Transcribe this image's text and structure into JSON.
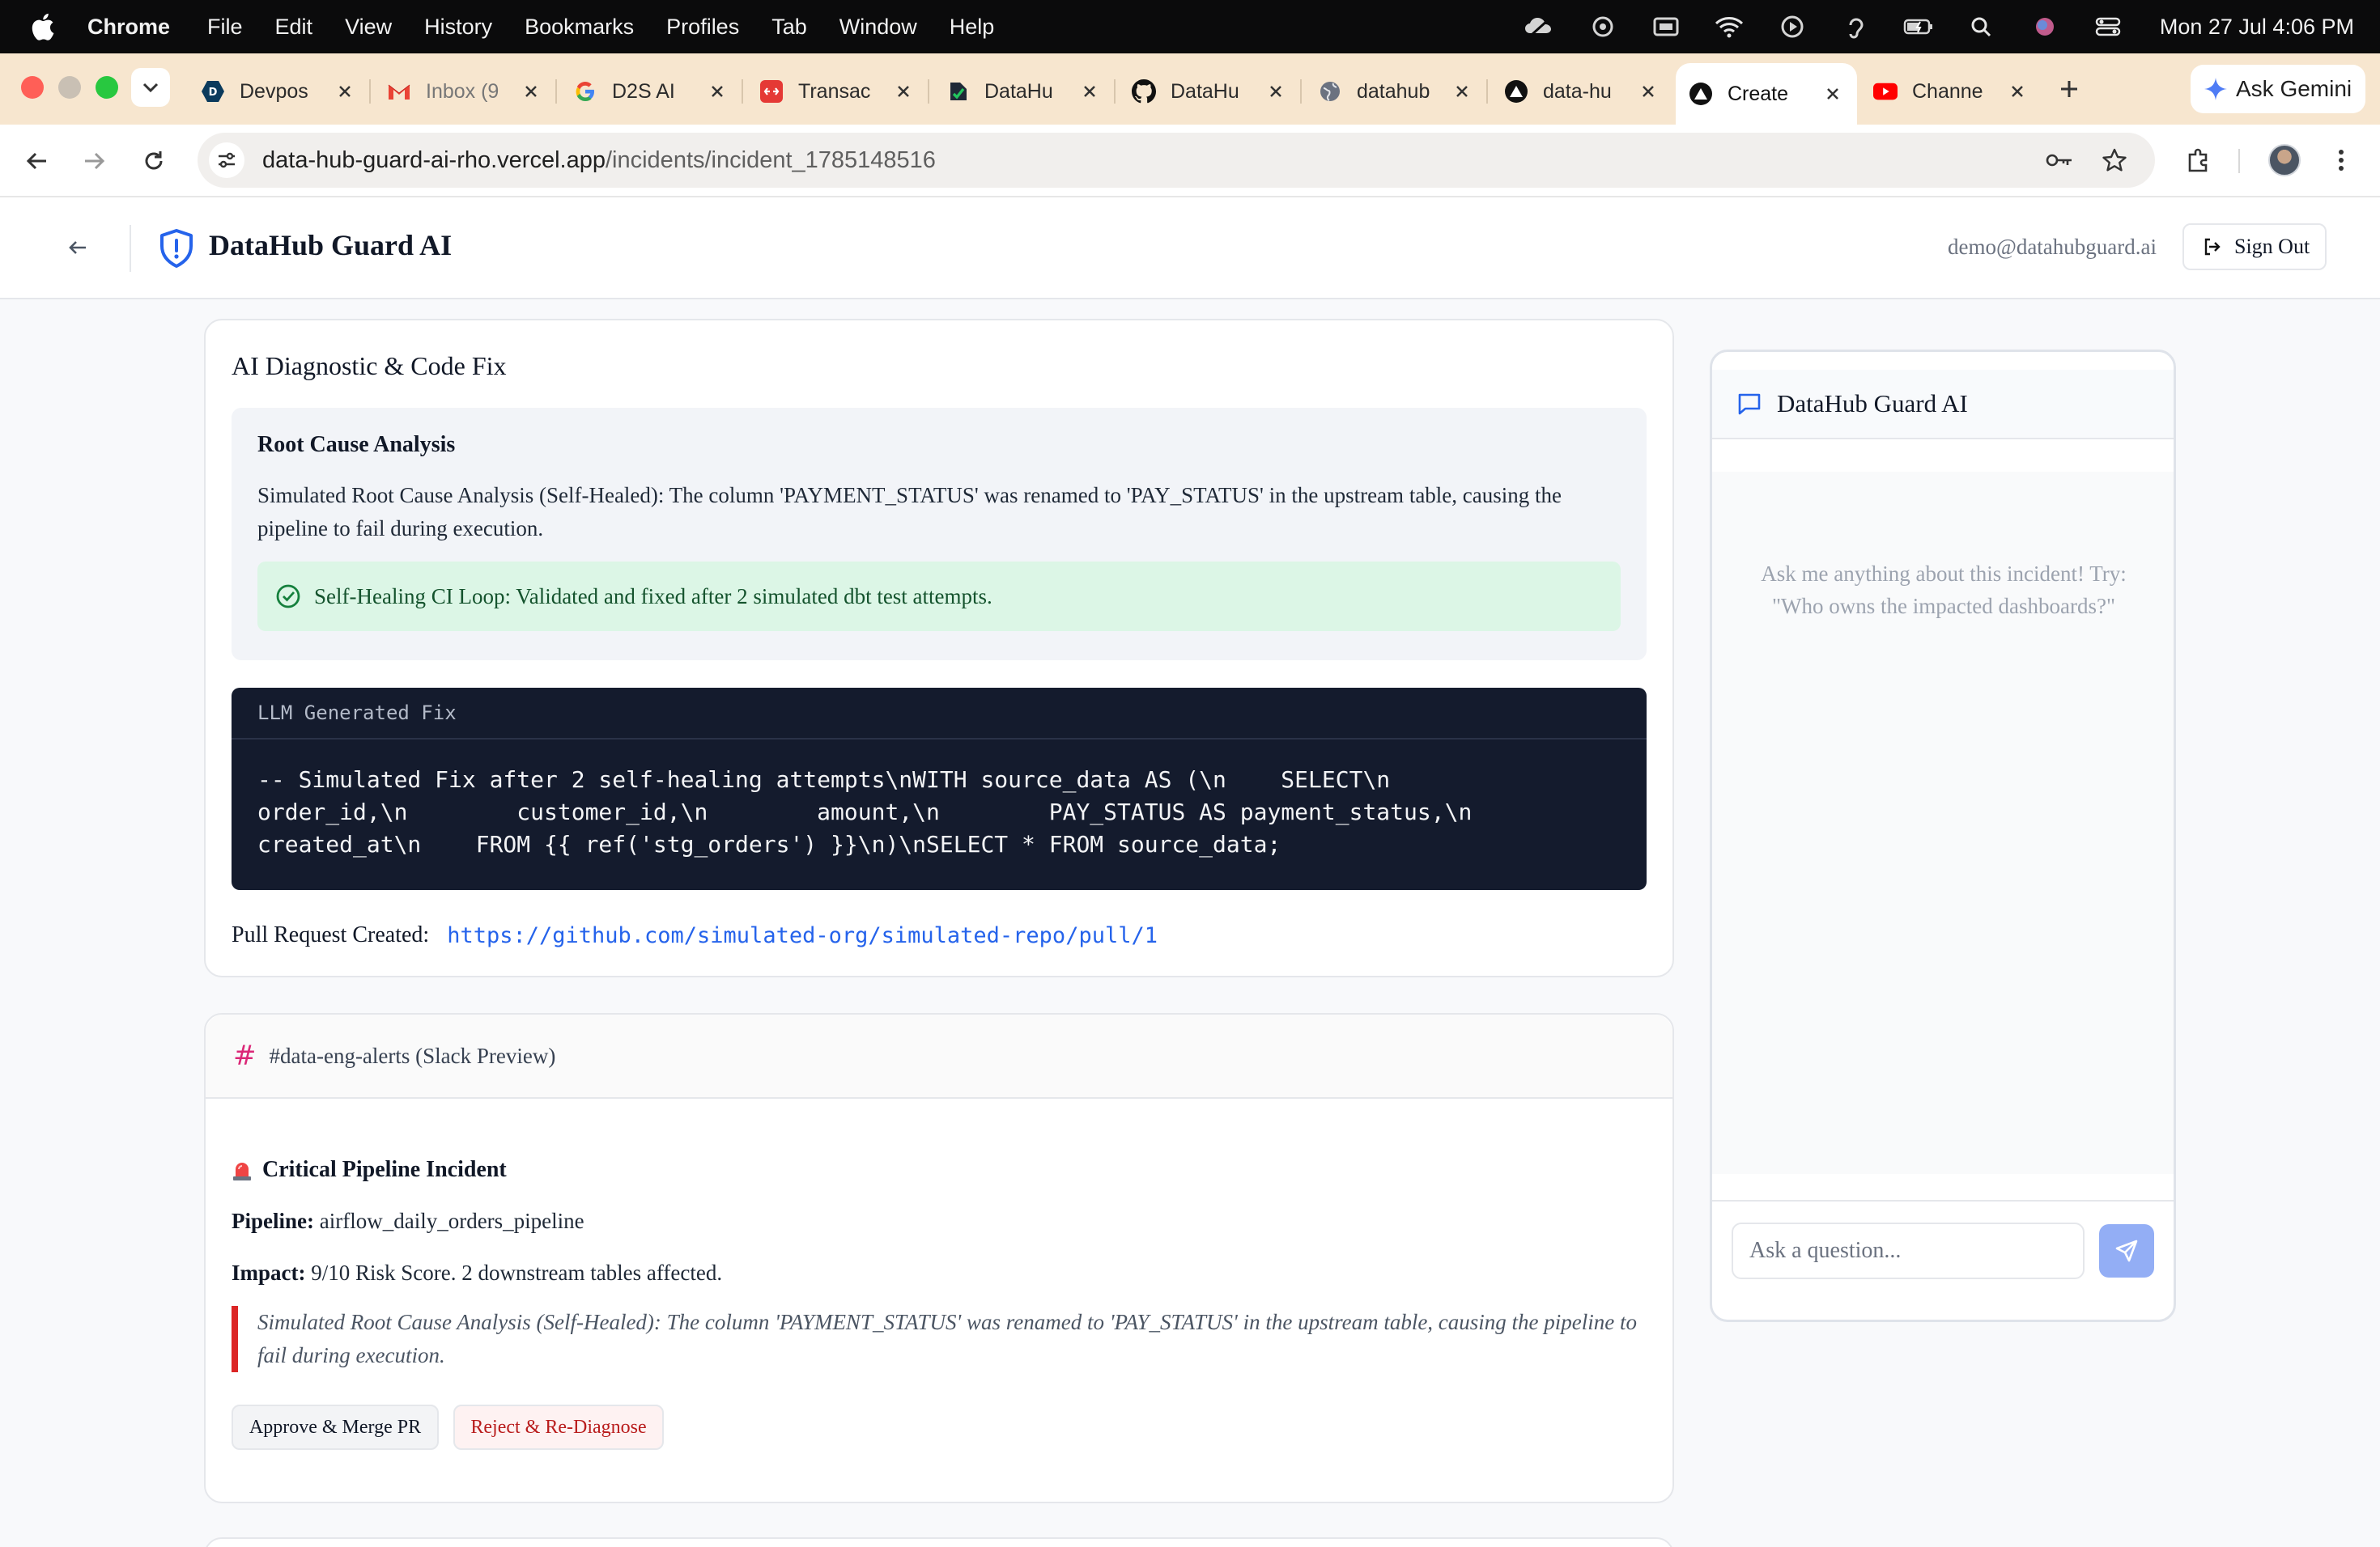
{
  "menubar": {
    "app": "Chrome",
    "items": [
      "File",
      "Edit",
      "View",
      "History",
      "Bookmarks",
      "Profiles",
      "Tab",
      "Window",
      "Help"
    ],
    "clock": "Mon 27 Jul  4:06 PM"
  },
  "tabs": [
    {
      "label": "Devpos",
      "icon": "devpost-icon"
    },
    {
      "label": "Inbox (9",
      "icon": "gmail-icon"
    },
    {
      "label": "D2S AI",
      "icon": "google-icon"
    },
    {
      "label": "Transac",
      "icon": "transaction-icon"
    },
    {
      "label": "DataHu",
      "icon": "datahub-icon"
    },
    {
      "label": "DataHu",
      "icon": "github-icon"
    },
    {
      "label": "datahub",
      "icon": "globe-icon"
    },
    {
      "label": "data-hu",
      "icon": "vercel-icon"
    },
    {
      "label": "Create",
      "icon": "vercel-icon",
      "active": true
    },
    {
      "label": "Channe",
      "icon": "youtube-icon"
    }
  ],
  "gemini": {
    "label": "Ask Gemini"
  },
  "address": {
    "host": "data-hub-guard-ai-rho.vercel.app",
    "path": "/incidents/incident_1785148516"
  },
  "header": {
    "brand": "DataHub Guard AI",
    "email": "demo@datahubguard.ai",
    "signout": "Sign Out"
  },
  "diagnostic": {
    "title": "AI Diagnostic & Code Fix",
    "rca_title": "Root Cause Analysis",
    "rca_text": "Simulated Root Cause Analysis (Self-Healed): The column 'PAYMENT_STATUS' was renamed to 'PAY_STATUS' in the upstream table, causing the pipeline to fail during execution.",
    "heal_text": "Self-Healing CI Loop: Validated and fixed after 2 simulated dbt test attempts.",
    "code_title": "LLM Generated Fix",
    "code_lines": [
      "-- Simulated Fix after 2 self-healing attempts\\nWITH source_data AS (\\n    SELECT\\n",
      "order_id,\\n        customer_id,\\n        amount,\\n        PAY_STATUS AS payment_status,\\n",
      "created_at\\n    FROM {{ ref('stg_orders') }}\\n)\\nSELECT * FROM source_data;"
    ],
    "pr_label": "Pull Request Created:",
    "pr_url": "https://github.com/simulated-org/simulated-repo/pull/1"
  },
  "slack": {
    "channel": "#data-eng-alerts (Slack Preview)",
    "incident_title": "Critical Pipeline Incident",
    "pipeline_label": "Pipeline:",
    "pipeline_value": "airflow_daily_orders_pipeline",
    "impact_label": "Impact:",
    "impact_value": "9/10 Risk Score. 2 downstream tables affected.",
    "quote": "Simulated Root Cause Analysis (Self-Healed): The column 'PAYMENT_STATUS' was renamed to 'PAY_STATUS' in the upstream table, causing the pipeline to fail during execution.",
    "approve": "Approve & Merge PR",
    "reject": "Reject & Re-Diagnose"
  },
  "chat": {
    "title": "DataHub Guard AI",
    "hint": "Ask me anything about this incident! Try: \"Who owns the impacted dashboards?\"",
    "placeholder": "Ask a question..."
  },
  "colors": {
    "accent": "#2563eb",
    "success_bg": "#dcf6e6",
    "danger": "#dc2626",
    "code_bg": "#141b2d"
  }
}
